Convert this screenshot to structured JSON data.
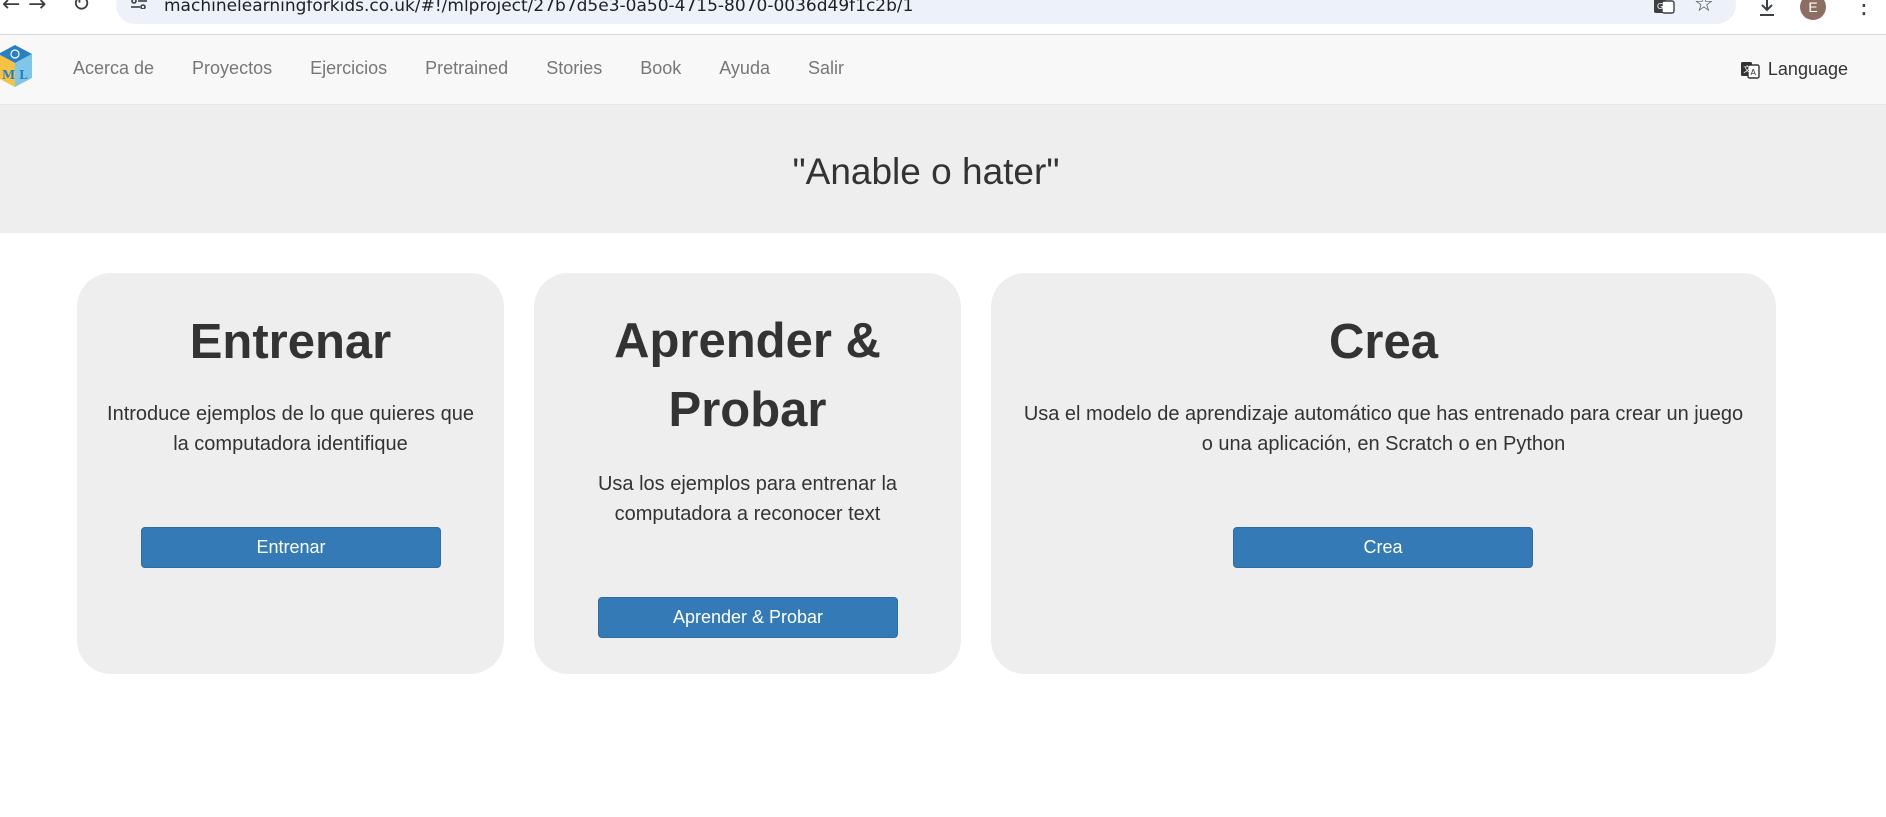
{
  "browser": {
    "url": "machinelearningforkids.co.uk/#!/mlproject/27b7d5e3-0a50-4715-8070-0036d49f1c2b/1",
    "avatar_initial": "E",
    "icons": [
      "back-icon",
      "forward-icon",
      "reload-icon",
      "site-info-icon",
      "translate-icon",
      "bookmark-star-icon",
      "download-icon",
      "menu-kebab-icon"
    ]
  },
  "navbar": {
    "links": [
      "Acerca de",
      "Proyectos",
      "Ejercicios",
      "Pretrained",
      "Stories",
      "Book",
      "Ayuda",
      "Salir"
    ],
    "language_label": "Language",
    "logo_letters": "M L"
  },
  "hero": {
    "title": "\"Anable o hater\""
  },
  "cards": {
    "train": {
      "title": "Entrenar",
      "description": "Introduce ejemplos de lo que quieres que la computadora identifique",
      "button": "Entrenar"
    },
    "learn": {
      "title": "Aprender & Probar",
      "description": "Usa los ejemplos para entrenar la computadora a reconocer text",
      "button": "Aprender & Probar"
    },
    "make": {
      "title": "Crea",
      "description": "Usa el modelo de aprendizaje automático que has entrenado para crear un juego o una aplicación, en Scratch o en Python",
      "button": "Crea"
    }
  },
  "colors": {
    "primary_button": "#337ab7",
    "card_background": "#eeeeee",
    "navbar_background": "#f8f8f8",
    "nav_link": "#777777"
  }
}
